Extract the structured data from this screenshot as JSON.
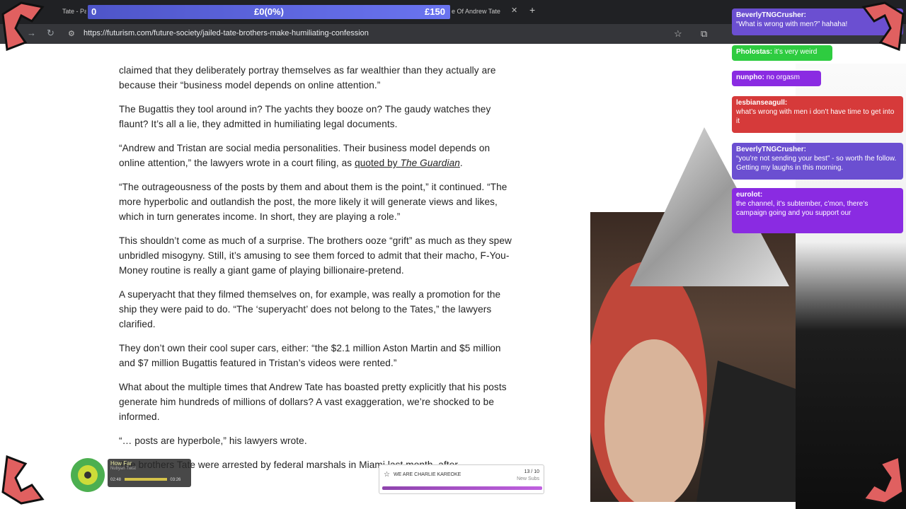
{
  "browser": {
    "tabs": [
      {
        "label": "Tate - Par"
      },
      {
        "label": "e Of Andrew Tate"
      }
    ],
    "new_tab": "+",
    "url": "https://futurism.com/future-society/jailed-tate-brothers-make-humiliating-confession"
  },
  "goal": {
    "left": "0",
    "center": "£0(0%)",
    "right": "£150"
  },
  "article": {
    "paragraphs": [
      "claimed that they deliberately portray themselves as far wealthier than they actually are because their “business model depends on online attention.”",
      "The Bugattis they tool around in? The yachts they booze on? The gaudy watches they flaunt? It’s all a lie, they admitted in humiliating legal documents.",
      "“The outrageousness of the posts by them and about them is the point,” it continued. “The more hyperbolic and outlandish the post, the more likely it will generate views and likes, which in turn generates income. In short, they are playing a role.”",
      "This shouldn’t come as much of a surprise. The brothers ooze “grift” as much as they spew unbridled misogyny. Still, it’s amusing to see them forced to admit that their macho, F-You-Money routine is really a giant game of playing billionaire-pretend.",
      "A superyacht that they filmed themselves on, for example, was really a promotion for the ship they were paid to do. “The ‘superyacht’ does not belong to the Tates,” the lawyers clarified.",
      "They don’t own their cool super cars, either: “the $2.1 million Aston Martin and $5 million and $7 million Bugattis featured in Tristan’s videos were rented.”",
      "What about the multiple times that Andrew Tate has boasted pretty explicitly that his posts generate him hundreds of millions of dollars? A vast exaggeration, we’re shocked to be informed.",
      "“… posts are hyperbole,” his lawyers wrote.",
      "The brothers Tate were arrested by federal marshals in Miami last month, after"
    ],
    "quote_para_start": "“Andrew and Tristan are social media personalities. Their business model depends on online attention,” the lawyers wrote in a court filing, as ",
    "quote_link": "quoted by ",
    "quote_link_italic": "The Guardian",
    "quote_end": "."
  },
  "chat": {
    "messages": [
      {
        "user": "BeverlyTNGCrusher:",
        "text": "“What is wrong with men?” hahaha!",
        "color": "#6b4fd1"
      },
      {
        "user": "Pholostas:",
        "text": "it’s very weird",
        "color": "#2ecc40"
      },
      {
        "user": "nunpho:",
        "text": "no orgasm",
        "color": "#8a2be2"
      },
      {
        "user": "lesbianseagull:",
        "text": "what’s wrong with men i don’t have time to get into it",
        "color": "#d63a3a"
      },
      {
        "user": "BeverlyTNGCrusher:",
        "text": "“you’re not sending your best” - so worth the follow. Getting my laughs in this morning.",
        "color": "#6b4fd1"
      },
      {
        "user": "eurolot:",
        "text": "the channel, it’s subtember, c’mon, there’s campaign going and you support our",
        "color": "#8a2be2"
      }
    ]
  },
  "music": {
    "title": "How Far",
    "artist": "Nubyan Twist",
    "elapsed": "02:48",
    "total": "03:26"
  },
  "subs": {
    "label": "WE ARE CHARLIE KAREOKE",
    "count": "13 / 10",
    "sub_label": "New Subs"
  }
}
